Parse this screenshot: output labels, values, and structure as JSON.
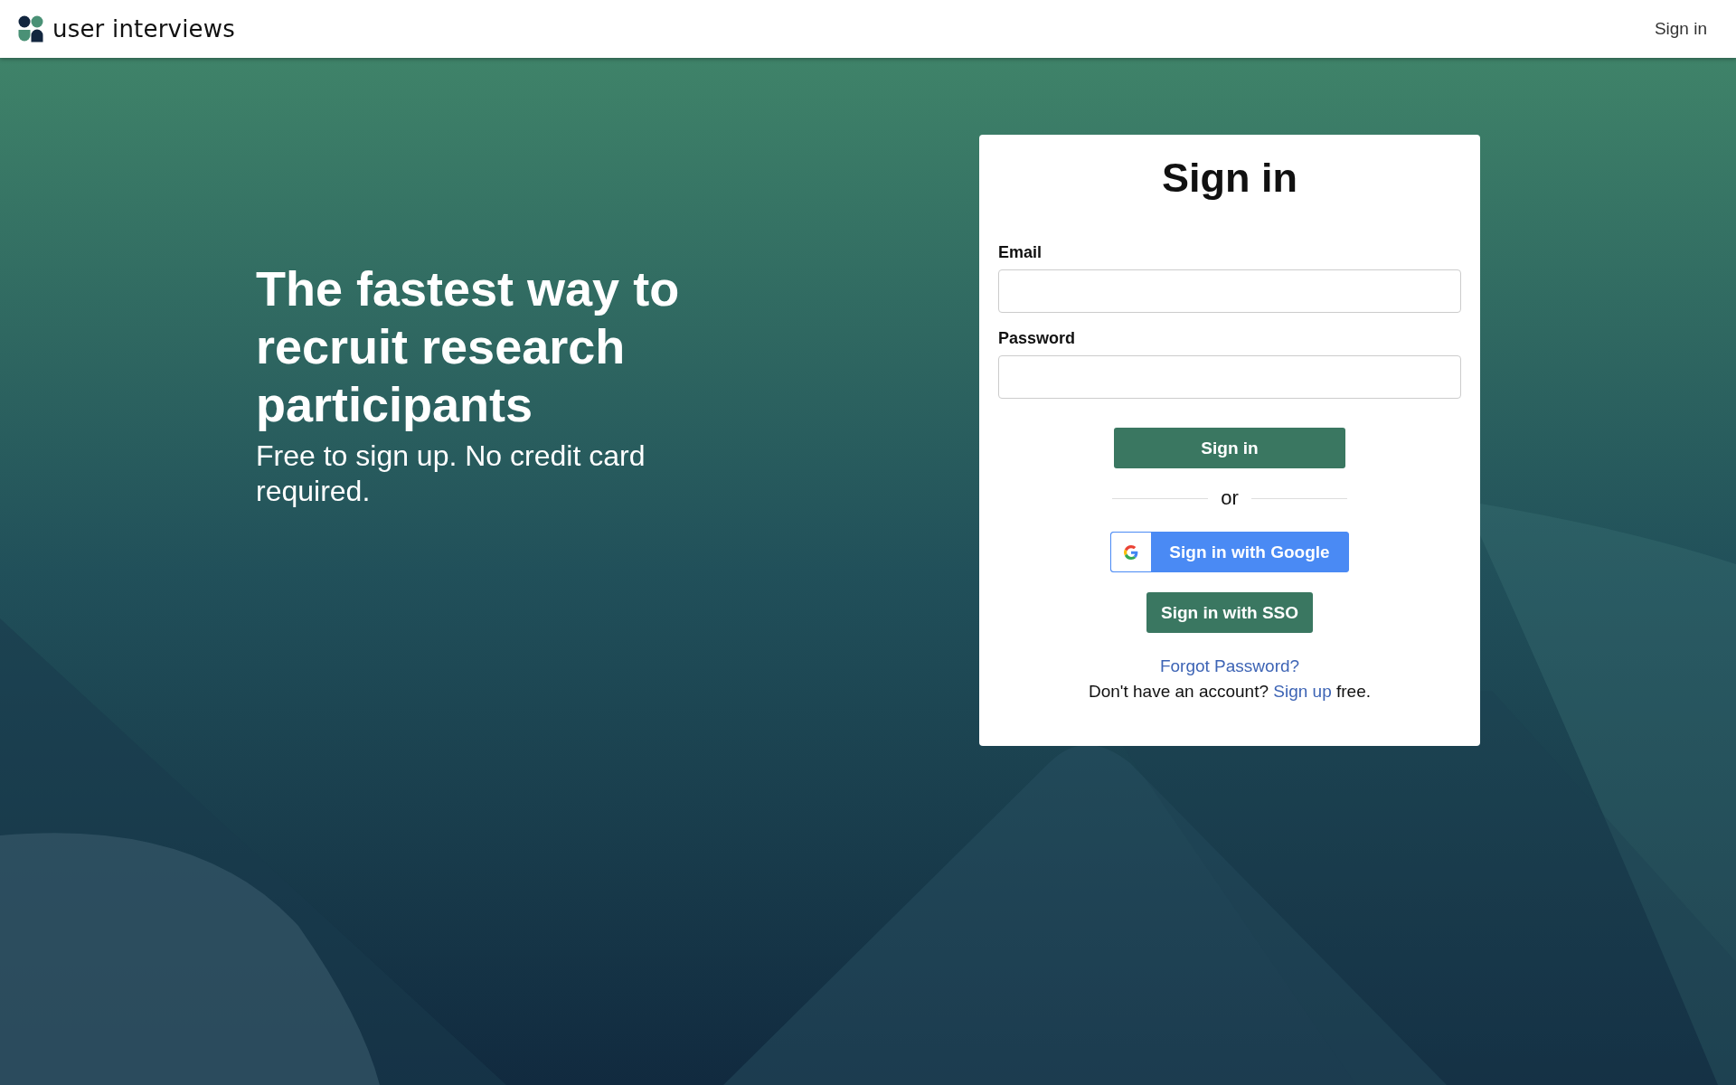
{
  "header": {
    "brand": "user interviews",
    "sign_in_link": "Sign in"
  },
  "hero": {
    "title": "The fastest way to recruit research participants",
    "subtitle": "Free to sign up. No credit card required."
  },
  "form": {
    "title": "Sign in",
    "fields": [
      {
        "label": "Email"
      },
      {
        "label": "Password"
      }
    ],
    "submit": "Sign in",
    "divider": "or",
    "providers": [
      {
        "kind": "google",
        "label": "Sign in with Google"
      },
      {
        "kind": "sso",
        "label": "Sign in with SSO"
      }
    ],
    "forgot": "Forgot Password?",
    "signup": {
      "before": "Don't have an account?",
      "link": "Sign up",
      "after": "free."
    }
  }
}
